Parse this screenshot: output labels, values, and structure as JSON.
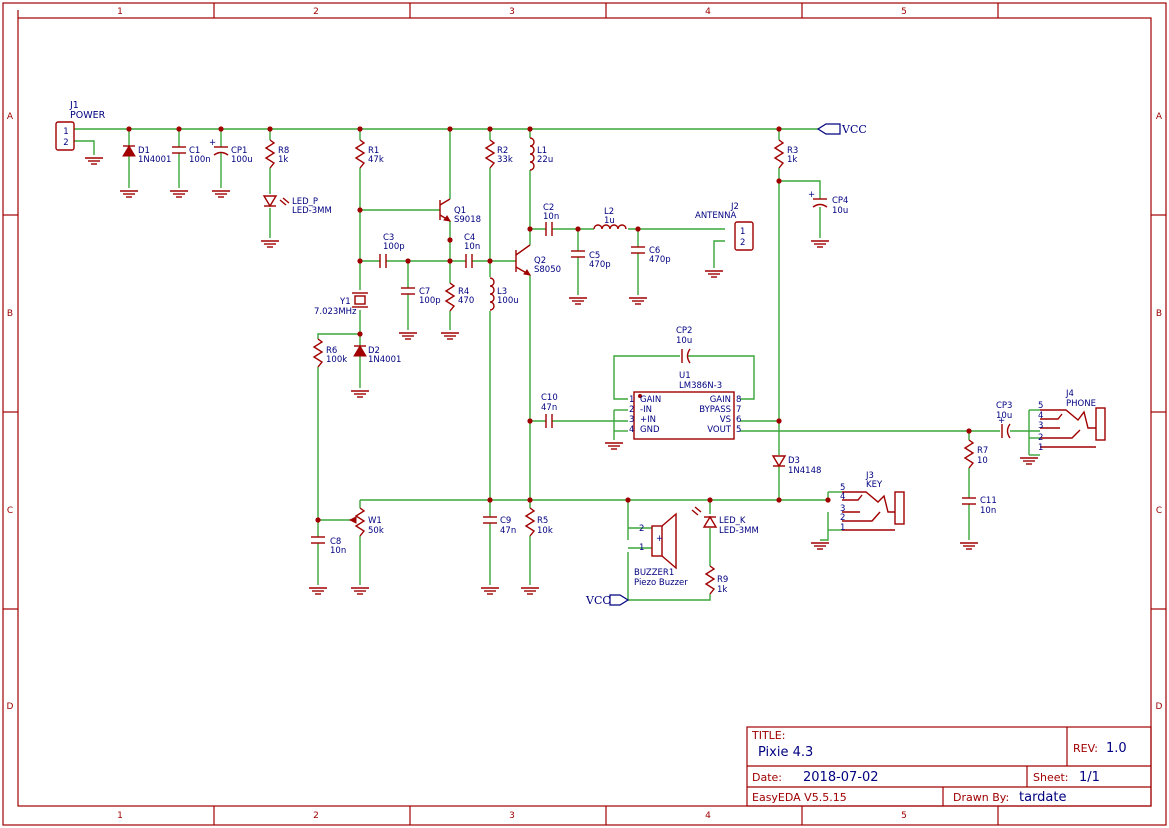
{
  "title_block": {
    "title_label": "TITLE:",
    "title": "Pixie 4.3",
    "rev_label": "REV:",
    "rev": "1.0",
    "date_label": "Date:",
    "date": "2018-07-02",
    "sheet_label": "Sheet:",
    "sheet": "1/1",
    "tool": "EasyEDA V5.5.15",
    "drawn_label": "Drawn By:",
    "drawn_by": "tardate"
  },
  "grid": {
    "columns": [
      "1",
      "2",
      "3",
      "4",
      "5"
    ],
    "rows": [
      "A",
      "B",
      "C",
      "D"
    ]
  },
  "nets": {
    "vcc_top": "VCC",
    "vcc_bottom": "VCC"
  },
  "components": {
    "j1": {
      "ref": "J1",
      "value": "POWER",
      "pins": [
        "1",
        "2"
      ]
    },
    "d1": {
      "ref": "D1",
      "value": "1N4001"
    },
    "c1": {
      "ref": "C1",
      "value": "100n"
    },
    "cp1": {
      "ref": "CP1",
      "value": "100u"
    },
    "r8": {
      "ref": "R8",
      "value": "1k"
    },
    "led_p": {
      "ref": "LED_P",
      "value": "LED-3MM"
    },
    "r1": {
      "ref": "R1",
      "value": "47k"
    },
    "q1": {
      "ref": "Q1",
      "value": "S9018"
    },
    "c3": {
      "ref": "C3",
      "value": "100p"
    },
    "c4": {
      "ref": "C4",
      "value": "10n"
    },
    "c7": {
      "ref": "C7",
      "value": "100p"
    },
    "r4": {
      "ref": "R4",
      "value": "470"
    },
    "y1": {
      "ref": "Y1",
      "value": "7.023MHz"
    },
    "r6": {
      "ref": "R6",
      "value": "100k"
    },
    "d2": {
      "ref": "D2",
      "value": "1N4001"
    },
    "r2": {
      "ref": "R2",
      "value": "33k"
    },
    "l1": {
      "ref": "L1",
      "value": "22u"
    },
    "l3": {
      "ref": "L3",
      "value": "100u"
    },
    "c2": {
      "ref": "C2",
      "value": "10n"
    },
    "q2": {
      "ref": "Q2",
      "value": "S8050"
    },
    "l2": {
      "ref": "L2",
      "value": "1u"
    },
    "c5": {
      "ref": "C5",
      "value": "470p"
    },
    "c6": {
      "ref": "C6",
      "value": "470p"
    },
    "j2": {
      "ref": "J2",
      "value": "ANTENNA",
      "pins": [
        "1",
        "2"
      ]
    },
    "r3": {
      "ref": "R3",
      "value": "1k"
    },
    "cp4": {
      "ref": "CP4",
      "value": "10u"
    },
    "cp2": {
      "ref": "CP2",
      "value": "10u"
    },
    "u1": {
      "ref": "U1",
      "value": "LM386N-3",
      "left_pins": [
        {
          "num": "1",
          "name": "GAIN"
        },
        {
          "num": "2",
          "name": "-IN"
        },
        {
          "num": "3",
          "name": "+IN"
        },
        {
          "num": "4",
          "name": "GND"
        }
      ],
      "right_pins": [
        {
          "num": "8",
          "name": "GAIN"
        },
        {
          "num": "7",
          "name": "BYPASS"
        },
        {
          "num": "6",
          "name": "VS"
        },
        {
          "num": "5",
          "name": "VOUT"
        }
      ]
    },
    "c10": {
      "ref": "C10",
      "value": "47n"
    },
    "d3": {
      "ref": "D3",
      "value": "1N4148"
    },
    "cp3": {
      "ref": "CP3",
      "value": "10u"
    },
    "r7": {
      "ref": "R7",
      "value": "10"
    },
    "c11": {
      "ref": "C11",
      "value": "10n"
    },
    "j4": {
      "ref": "J4",
      "value": "PHONE",
      "pins": [
        "5",
        "4",
        "3",
        "2",
        "1"
      ]
    },
    "j3": {
      "ref": "J3",
      "value": "KEY",
      "pins": [
        "5",
        "4",
        "3",
        "2",
        "1"
      ]
    },
    "w1": {
      "ref": "W1",
      "value": "50k"
    },
    "c8": {
      "ref": "C8",
      "value": "10n"
    },
    "c9": {
      "ref": "C9",
      "value": "47n"
    },
    "r5": {
      "ref": "R5",
      "value": "10k"
    },
    "buzzer": {
      "ref": "BUZZER1",
      "value": "Piezo Buzzer",
      "pins": [
        "2",
        "1"
      ]
    },
    "led_k": {
      "ref": "LED_K",
      "value": "LED-3MM"
    },
    "r9": {
      "ref": "R9",
      "value": "1k"
    }
  },
  "colors": {
    "wire": "#3aa63a",
    "part": "#a00000",
    "text": "#000080",
    "frame": "#a00000"
  }
}
